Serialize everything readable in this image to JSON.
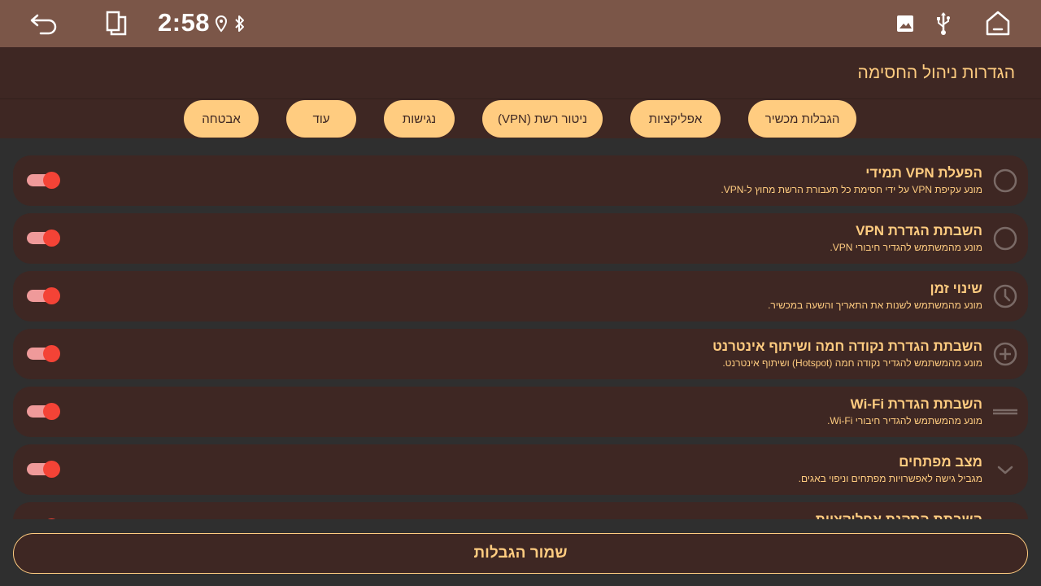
{
  "status_bar": {
    "clock": "2:58",
    "icons": [
      "back-icon",
      "recents-icon",
      "location-icon",
      "bluetooth-icon",
      "image-icon",
      "usb-icon",
      "home-icon"
    ]
  },
  "header": {
    "title": "הגדרות ניהול החסימה"
  },
  "tabs": [
    {
      "label": "אבטחה"
    },
    {
      "label": "עוד"
    },
    {
      "label": "נגישות"
    },
    {
      "label": "ניטור רשת (VPN)"
    },
    {
      "label": "אפליקציות"
    },
    {
      "label": "הגבלות מכשיר"
    }
  ],
  "rows": [
    {
      "title": "הפעלת VPN תמידי",
      "desc": "מונע עקיפת VPN על ידי חסימת כל תעבורת הרשת מחוץ ל-VPN.",
      "icon": "circle-outline-icon",
      "enabled": true
    },
    {
      "title": "השבתת הגדרת VPN",
      "desc": "מונע מהמשתמש להגדיר חיבורי VPN.",
      "icon": "circle-outline-icon",
      "enabled": true
    },
    {
      "title": "שינוי זמן",
      "desc": "מונע מהמשתמש לשנות את התאריך והשעה במכשיר.",
      "icon": "clock-icon",
      "enabled": true
    },
    {
      "title": "השבתת הגדרת נקודה חמה ושיתוף אינטרנט",
      "desc": "מונע מהמשתמש להגדיר נקודה חמה (Hotspot) ושיתוף אינטרנט.",
      "icon": "plus-circle-icon",
      "enabled": true
    },
    {
      "title": "השבתת הגדרת Wi-Fi",
      "desc": "מונע מהמשתמש להגדיר חיבורי Wi-Fi.",
      "icon": "equals-icon",
      "enabled": true
    },
    {
      "title": "מצב מפתחים",
      "desc": "מגביל גישה לאפשרויות מפתחים וניפוי באגים.",
      "icon": "chevron-down-icon",
      "enabled": true
    },
    {
      "title": "השבתת התקנת אפליקציות",
      "desc": "",
      "icon": "chevron-icon",
      "enabled": true
    }
  ],
  "footer": {
    "save_label": "שמור הגבלות"
  },
  "colors": {
    "status_bar": "#7b5648",
    "surface": "#3e2723",
    "accent": "#ffcc80",
    "toggle_on": "#f44336",
    "background": "#2f2f2f"
  }
}
